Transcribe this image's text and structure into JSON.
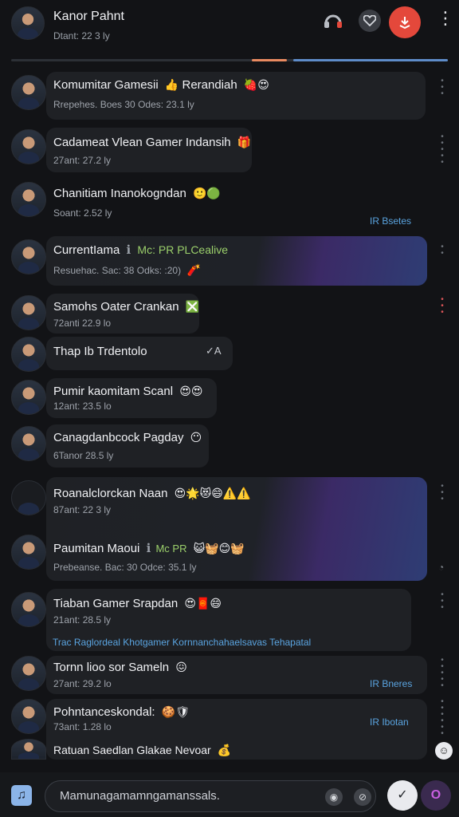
{
  "header": {
    "title": "Kanor Pahnt",
    "subtitle": "Dtant: 22 3 ly"
  },
  "chats": [
    {
      "title": "Komumitar Gamesii",
      "emoji": "👍",
      "title2": "Rerandiah",
      "emoji2": "🍓😍",
      "subtitle": "Rrepehes. Boes 30 Odes: 23.1 ly"
    },
    {
      "title": "Cadameat Vlean Gamer Indansih",
      "emoji": "🎁",
      "subtitle": "27ant: 27.2 ly"
    },
    {
      "title": "Chanitiam Inanokogndan",
      "emoji": "🙂🟢",
      "subtitle": "Soant: 2.52 ly",
      "right_link": "IR Bsetes"
    },
    {
      "title": "CurrentIama",
      "tag": "Mc: PR PLCealive",
      "subtitle": "Resuehac. Sac: 38 Odks: :20)",
      "emoji": "🧨"
    },
    {
      "title": "Samohs Oater Crankan",
      "emoji": "❎",
      "subtitle": "72anti 22.9 lo"
    },
    {
      "title": "Thap Ib Trdentolo",
      "emoji": "✓A"
    },
    {
      "title": "Pumir kaomitam Scanl",
      "emoji": "😍😍",
      "subtitle": "12ant: 23.5 lo"
    },
    {
      "title": "Canagdanbcock Pagday",
      "emoji": "😶",
      "subtitle": "6Tanor 28.5 ly"
    },
    {
      "title": "Roanalclorckan Naan",
      "emoji": "😍🌟😻😄⚠️⚠️",
      "subtitle": "87ant: 22 3 ly"
    },
    {
      "title": "Paumitan Maoui",
      "tag": "Mc PR",
      "emoji": "😺🧺😊🧺",
      "subtitle": "Prebeanse. Bac: 30 Odce: 35.1 ly"
    },
    {
      "title": "Tiaban Gamer Srapdan",
      "emoji": "😍🧧😄",
      "subtitle": "21ant: 28.5 ly",
      "link": "Trac Raglordeal Khotgamer Kornnanchahaelsavas Tehapatal"
    },
    {
      "title": "Tornn lioo sor Sameln",
      "emoji": "😖",
      "subtitle": "27ant: 29.2 lo",
      "right_link": "IR Bneres"
    },
    {
      "title": "Pohntanceskondal:",
      "emoji": "🍪🛡",
      "subtitle": "73ant: 1.28 lo",
      "right_link": "IR Ibotan"
    },
    {
      "title": "Ratuan Saedlan Glakae Nevoar",
      "emoji": "💰"
    }
  ],
  "composer": {
    "placeholder": "Mamunagamamngamanssals."
  },
  "colors": {
    "background": "#121316",
    "accent_red": "#e4483b",
    "link_blue": "#5aa4e0",
    "bubble": "#1f2125"
  },
  "icons": [
    "headset-icon",
    "heart-icon",
    "share-icon",
    "more-vert-icon",
    "music-note-icon",
    "emoji-icon",
    "attach-icon",
    "check-shield-icon",
    "mic-icon"
  ]
}
